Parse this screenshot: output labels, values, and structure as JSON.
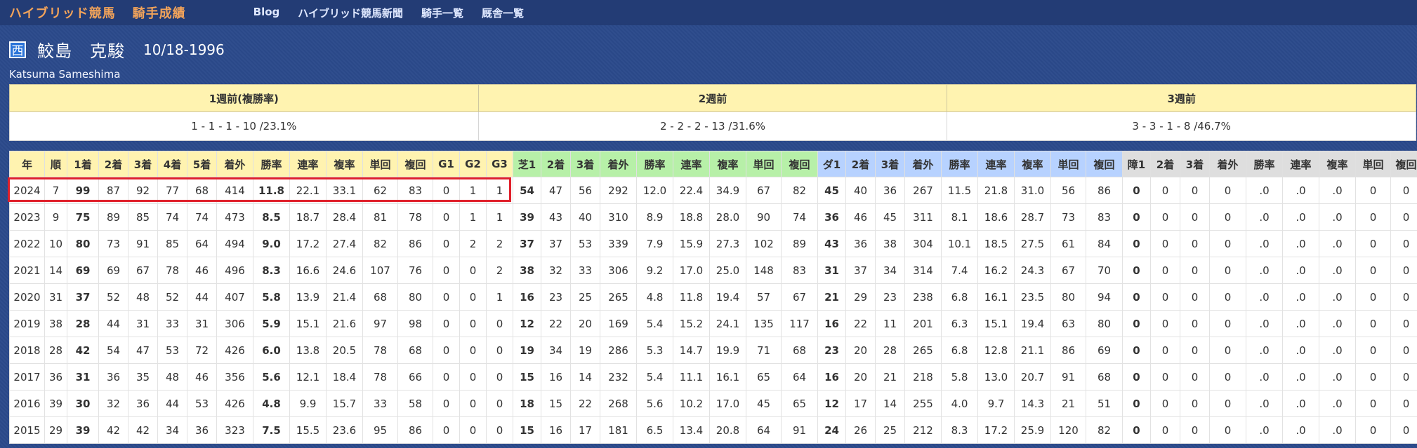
{
  "topbar": {
    "brand": "ハイブリッド競馬",
    "section": "騎手成績",
    "nav": [
      "Blog",
      "ハイブリッド競馬新聞",
      "騎手一覧",
      "厩舎一覧"
    ]
  },
  "jockey": {
    "region_badge": "西",
    "name": "鮫島　克駿",
    "birth": "10/18-1996",
    "romaji": "Katsuma Sameshima"
  },
  "weekly": {
    "headers": [
      "1週前(複勝率)",
      "2週前",
      "3週前"
    ],
    "values": [
      "1 - 1 - 1 - 10 /23.1%",
      "2 - 2 - 2 - 13 /31.6%",
      "3 - 3 - 1 - 8 /46.7%"
    ]
  },
  "stats": {
    "headers": [
      "年",
      "順",
      "1着",
      "2着",
      "3着",
      "4着",
      "5着",
      "着外",
      "勝率",
      "連率",
      "複率",
      "単回",
      "複回",
      "G1",
      "G2",
      "G3",
      "芝1",
      "2着",
      "3着",
      "着外",
      "勝率",
      "連率",
      "複率",
      "単回",
      "複回",
      "ダ1",
      "2着",
      "3着",
      "着外",
      "勝率",
      "連率",
      "複率",
      "単回",
      "複回",
      "障1",
      "2着",
      "3着",
      "着外",
      "勝率",
      "連率",
      "複率",
      "単回",
      "複回"
    ],
    "rows": [
      [
        "2024",
        "7",
        "99",
        "87",
        "92",
        "77",
        "68",
        "414",
        "11.8",
        "22.1",
        "33.1",
        "62",
        "83",
        "0",
        "1",
        "1",
        "54",
        "47",
        "56",
        "292",
        "12.0",
        "22.4",
        "34.9",
        "67",
        "82",
        "45",
        "40",
        "36",
        "267",
        "11.5",
        "21.8",
        "31.0",
        "56",
        "86",
        "0",
        "0",
        "0",
        "0",
        ".0",
        ".0",
        ".0",
        "0",
        "0"
      ],
      [
        "2023",
        "9",
        "75",
        "89",
        "85",
        "74",
        "74",
        "473",
        "8.5",
        "18.7",
        "28.4",
        "81",
        "78",
        "0",
        "1",
        "1",
        "39",
        "43",
        "40",
        "310",
        "8.9",
        "18.8",
        "28.0",
        "90",
        "74",
        "36",
        "46",
        "45",
        "311",
        "8.1",
        "18.6",
        "28.7",
        "73",
        "83",
        "0",
        "0",
        "0",
        "0",
        ".0",
        ".0",
        ".0",
        "0",
        "0"
      ],
      [
        "2022",
        "10",
        "80",
        "73",
        "91",
        "85",
        "64",
        "494",
        "9.0",
        "17.2",
        "27.4",
        "82",
        "86",
        "0",
        "2",
        "2",
        "37",
        "37",
        "53",
        "339",
        "7.9",
        "15.9",
        "27.3",
        "102",
        "89",
        "43",
        "36",
        "38",
        "304",
        "10.1",
        "18.5",
        "27.5",
        "61",
        "84",
        "0",
        "0",
        "0",
        "0",
        ".0",
        ".0",
        ".0",
        "0",
        "0"
      ],
      [
        "2021",
        "14",
        "69",
        "69",
        "67",
        "78",
        "46",
        "496",
        "8.3",
        "16.6",
        "24.6",
        "107",
        "76",
        "0",
        "0",
        "2",
        "38",
        "32",
        "33",
        "306",
        "9.2",
        "17.0",
        "25.0",
        "148",
        "83",
        "31",
        "37",
        "34",
        "314",
        "7.4",
        "16.2",
        "24.3",
        "67",
        "70",
        "0",
        "0",
        "0",
        "0",
        ".0",
        ".0",
        ".0",
        "0",
        "0"
      ],
      [
        "2020",
        "31",
        "37",
        "52",
        "48",
        "52",
        "44",
        "407",
        "5.8",
        "13.9",
        "21.4",
        "68",
        "80",
        "0",
        "0",
        "1",
        "16",
        "23",
        "25",
        "265",
        "4.8",
        "11.8",
        "19.4",
        "57",
        "67",
        "21",
        "29",
        "23",
        "238",
        "6.8",
        "16.1",
        "23.5",
        "80",
        "94",
        "0",
        "0",
        "0",
        "0",
        ".0",
        ".0",
        ".0",
        "0",
        "0"
      ],
      [
        "2019",
        "38",
        "28",
        "44",
        "31",
        "33",
        "31",
        "306",
        "5.9",
        "15.1",
        "21.6",
        "97",
        "98",
        "0",
        "0",
        "0",
        "12",
        "22",
        "20",
        "169",
        "5.4",
        "15.2",
        "24.1",
        "135",
        "117",
        "16",
        "22",
        "11",
        "201",
        "6.3",
        "15.1",
        "19.4",
        "63",
        "80",
        "0",
        "0",
        "0",
        "0",
        ".0",
        ".0",
        ".0",
        "0",
        "0"
      ],
      [
        "2018",
        "28",
        "42",
        "54",
        "47",
        "53",
        "72",
        "426",
        "6.0",
        "13.8",
        "20.5",
        "78",
        "68",
        "0",
        "0",
        "0",
        "19",
        "34",
        "19",
        "286",
        "5.3",
        "14.7",
        "19.9",
        "71",
        "68",
        "23",
        "20",
        "28",
        "265",
        "6.8",
        "12.8",
        "21.1",
        "86",
        "69",
        "0",
        "0",
        "0",
        "0",
        ".0",
        ".0",
        ".0",
        "0",
        "0"
      ],
      [
        "2017",
        "36",
        "31",
        "36",
        "35",
        "48",
        "46",
        "356",
        "5.6",
        "12.1",
        "18.4",
        "78",
        "66",
        "0",
        "0",
        "0",
        "15",
        "16",
        "14",
        "232",
        "5.4",
        "11.1",
        "16.1",
        "65",
        "64",
        "16",
        "20",
        "21",
        "218",
        "5.8",
        "13.0",
        "20.7",
        "91",
        "68",
        "0",
        "0",
        "0",
        "0",
        ".0",
        ".0",
        ".0",
        "0",
        "0"
      ],
      [
        "2016",
        "39",
        "30",
        "32",
        "36",
        "44",
        "53",
        "426",
        "4.8",
        "9.9",
        "15.7",
        "33",
        "58",
        "0",
        "0",
        "0",
        "18",
        "15",
        "22",
        "268",
        "5.6",
        "10.2",
        "17.0",
        "45",
        "65",
        "12",
        "17",
        "14",
        "255",
        "4.0",
        "9.7",
        "14.3",
        "21",
        "51",
        "0",
        "0",
        "0",
        "0",
        ".0",
        ".0",
        ".0",
        "0",
        "0"
      ],
      [
        "2015",
        "29",
        "39",
        "42",
        "42",
        "34",
        "36",
        "323",
        "7.5",
        "15.5",
        "23.6",
        "95",
        "86",
        "0",
        "0",
        "0",
        "15",
        "16",
        "17",
        "181",
        "6.5",
        "13.4",
        "20.8",
        "64",
        "91",
        "24",
        "26",
        "25",
        "212",
        "8.3",
        "17.2",
        "25.9",
        "120",
        "82",
        "0",
        "0",
        "0",
        "0",
        ".0",
        ".0",
        ".0",
        "0",
        "0"
      ]
    ]
  }
}
